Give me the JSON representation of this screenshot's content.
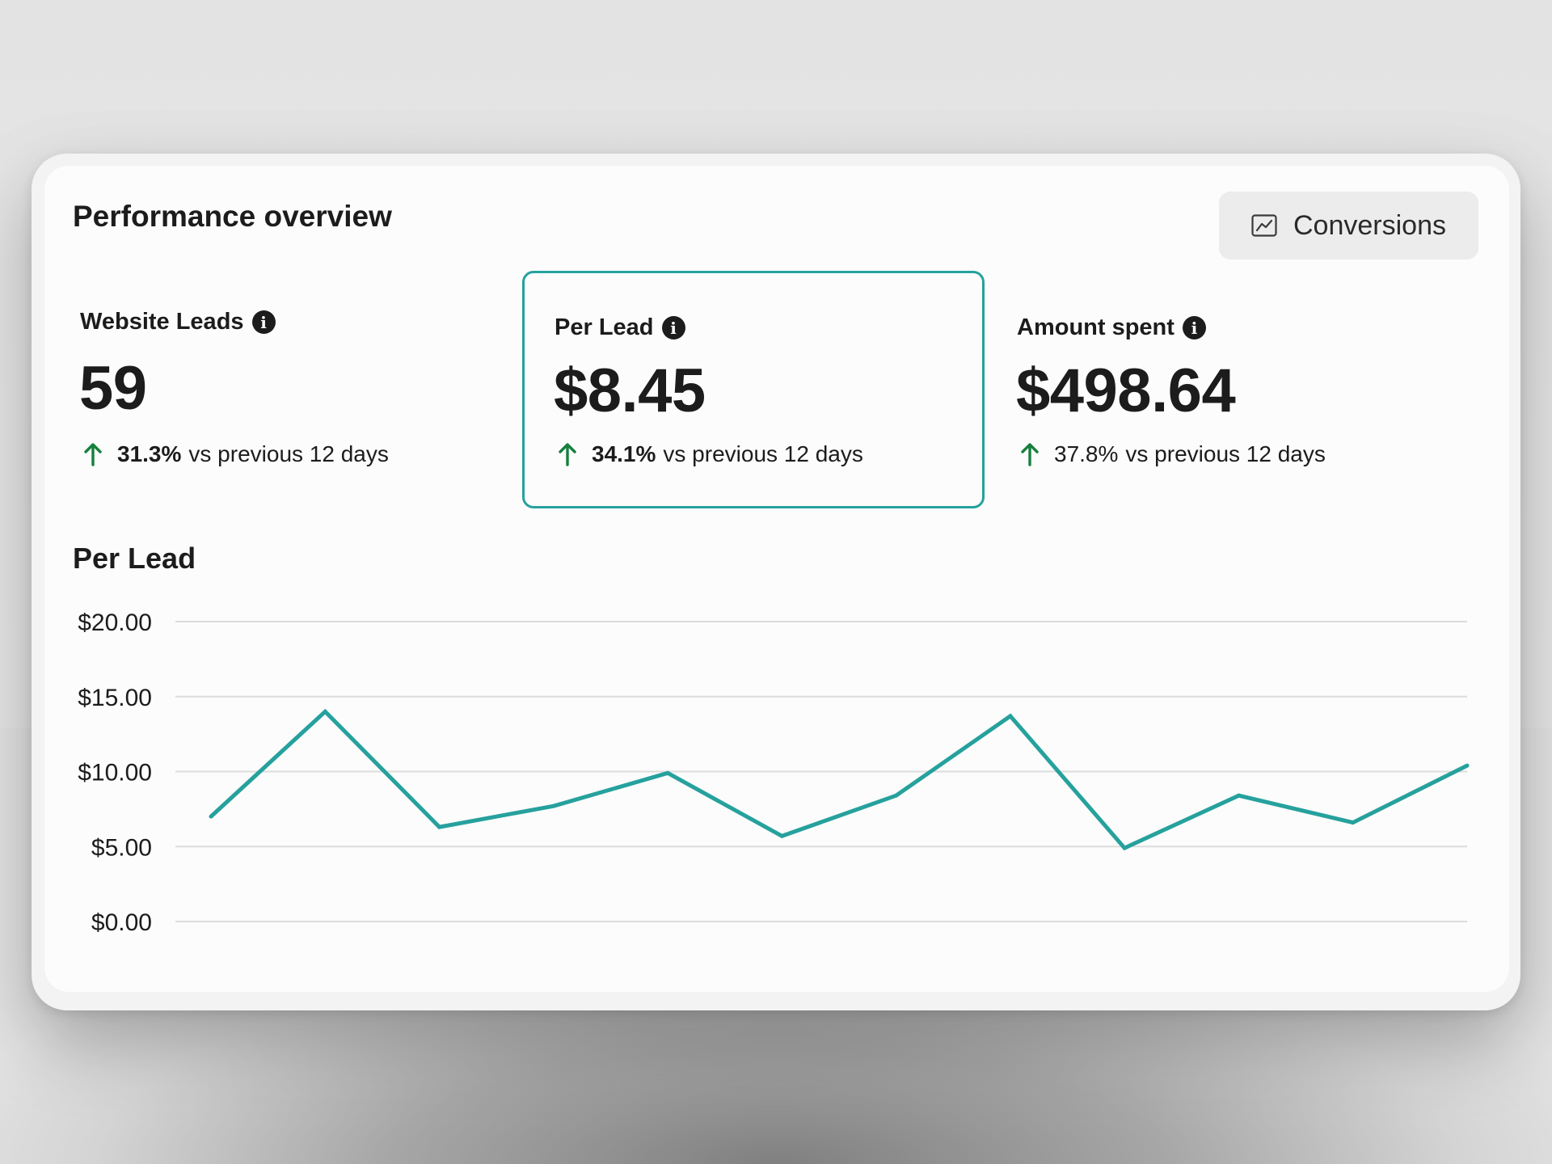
{
  "header": {
    "title": "Performance overview",
    "conversions_button": "Conversions",
    "conversions_icon": "line-chart-icon"
  },
  "metrics": [
    {
      "label": "Website Leads",
      "value": "59",
      "change_pct": "31.3%",
      "change_text": "vs previous 12 days",
      "direction": "up",
      "selected": false
    },
    {
      "label": "Per Lead",
      "value": "$8.45",
      "change_pct": "34.1%",
      "change_text": "vs previous 12 days",
      "direction": "up",
      "selected": true
    },
    {
      "label": "Amount spent",
      "value": "$498.64",
      "change_pct": "37.8%",
      "change_text": "vs previous 12 days",
      "direction": "up",
      "selected": false
    }
  ],
  "colors": {
    "accent": "#26a19d",
    "up_arrow": "#15803d",
    "text": "#1c1c1c",
    "gridline": "#dcdcdc"
  },
  "chart_data": {
    "type": "line",
    "title": "Per Lead",
    "xlabel": "",
    "ylabel": "",
    "yticks": [
      "$20.00",
      "$15.00",
      "$10.00",
      "$5.00",
      "$0.00"
    ],
    "ylim": [
      0,
      20
    ],
    "grid": true,
    "series": [
      {
        "values": [
          7.0,
          14.0,
          6.3,
          7.7,
          9.9,
          5.7,
          8.4,
          13.7,
          4.9,
          8.4,
          6.6,
          10.4
        ]
      }
    ]
  }
}
